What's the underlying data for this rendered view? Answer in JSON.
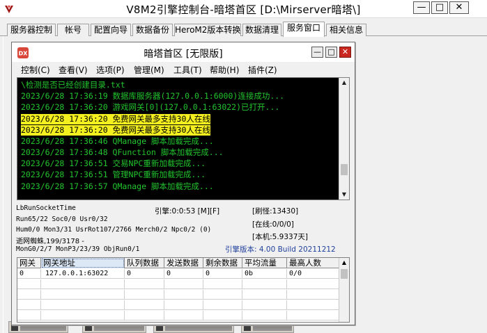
{
  "window": {
    "title": "V8M2引擎控制台-暗塔首区 [D:\\Mirserver暗塔\\]",
    "minimize": "—",
    "maximize": "□",
    "close": "✕"
  },
  "tabs": [
    {
      "label": "服务器控制"
    },
    {
      "label": "帐号"
    },
    {
      "label": "配置向导"
    },
    {
      "label": "数据备份"
    },
    {
      "label": "HeroM2版本转换"
    },
    {
      "label": "数据清理"
    },
    {
      "label": "服务窗口",
      "active": true
    },
    {
      "label": "相关信息"
    }
  ],
  "inner_window": {
    "title": "暗塔首区 [无限版]",
    "icon_text": "DX",
    "minimize": "—",
    "maximize": "□",
    "close": "✕",
    "menu": [
      {
        "label": "控制(C)"
      },
      {
        "label": "查看(V)"
      },
      {
        "label": "选项(P)"
      },
      {
        "label": "管理(M)"
      },
      {
        "label": "工具(T)"
      },
      {
        "label": "帮助(H)"
      },
      {
        "label": "插件(Z)"
      }
    ]
  },
  "log": {
    "lines": [
      {
        "text": "\\检测是否已经创建目录.txt",
        "highlight": false
      },
      {
        "text": "2023/6/28 17:36:19 数据库服务器(127.0.0.1:6000)连接成功...",
        "highlight": false
      },
      {
        "text": "2023/6/28 17:36:20 游戏网关[0](127.0.0.1:63022)已打开...",
        "highlight": false
      },
      {
        "text": "2023/6/28 17:36:20 免费网关最多支持30人在线",
        "highlight": true
      },
      {
        "text": "2023/6/28 17:36:20 免费网关最多支持30人在线",
        "highlight": true
      },
      {
        "text": "2023/6/28 17:36:46 QManage 脚本加载完成...",
        "highlight": false
      },
      {
        "text": "2023/6/28 17:36:48 QFunction 脚本加载完成...",
        "highlight": false
      },
      {
        "text": "2023/6/28 17:36:51 交易NPC重新加载完成...",
        "highlight": false
      },
      {
        "text": "2023/6/28 17:36:51 管理NPC重新加载完成...",
        "highlight": false
      },
      {
        "text": "2023/6/28 17:36:57 QManage 脚本加载完成...",
        "highlight": false
      }
    ]
  },
  "status": {
    "socket_time": "LbRunSocketTime",
    "engine_time": "引擎:0:0:53 [M][F]",
    "refresh_monsters": "[刷怪:13430]",
    "run": "Run65/22 Soc0/0 Usr0/32",
    "online": "[在线:0/0/0]",
    "hum": "Hum0/0 Mon3/31 UsrRot107/2766 Merch0/2 Npc0/2 (0)",
    "uptime": "[本机:5.9337天]",
    "spider": "逝网蜘蛛,199/3178 -",
    "mon_gen": "MonG0/2/7 MonP3/23/39 ObjRun0/1",
    "version": "引擎版本: 4.00 Build 20211212"
  },
  "grid": {
    "headers": [
      "网关",
      "网关地址",
      "队列数据",
      "发送数据",
      "剩余数据",
      "平均流量",
      "最高人数"
    ],
    "rows": [
      [
        "0",
        "127.0.0.1:63022",
        "0",
        "0",
        "0",
        "0b",
        "0/0"
      ],
      [
        "",
        "",
        "",
        "",
        "",
        "",
        ""
      ],
      [
        "",
        "",
        "",
        "",
        "",
        "",
        ""
      ],
      [
        "",
        "",
        "",
        "",
        "",
        "",
        ""
      ],
      [
        "",
        "",
        "",
        "",
        "",
        "",
        ""
      ]
    ]
  },
  "colors": {
    "log_background": "#000000",
    "log_text": "#22c42e",
    "log_highlight": "#f4f020",
    "version_text": "#1f3f9c",
    "close_button": "#c9281e"
  }
}
